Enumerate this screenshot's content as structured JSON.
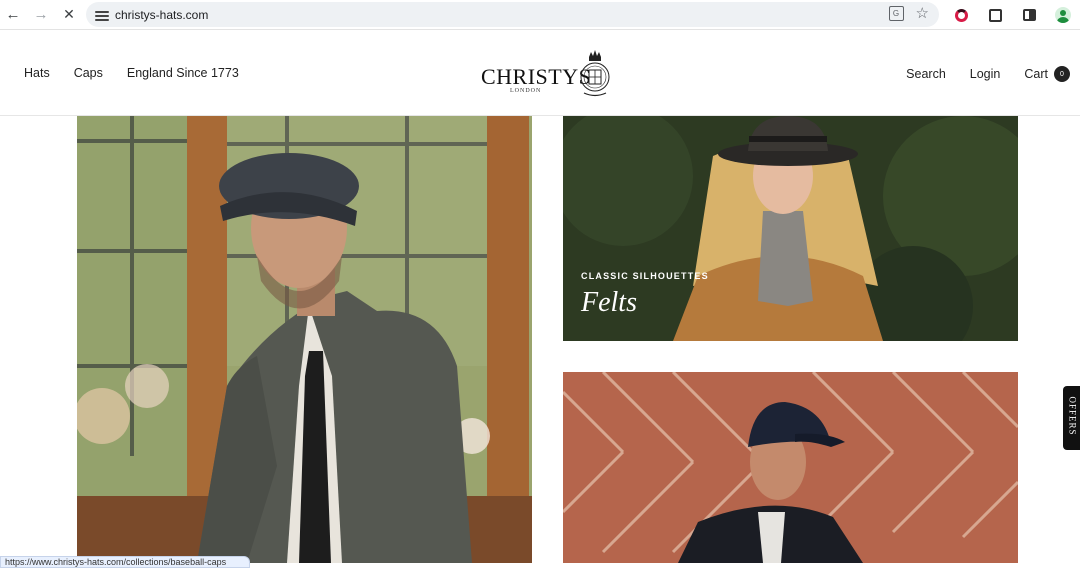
{
  "browser": {
    "url": "christys-hats.com"
  },
  "header": {
    "nav_left": [
      "Hats",
      "Caps",
      "England Since 1773"
    ],
    "logo_text": "CHRISTYS'",
    "logo_sub": "LONDON",
    "search_label": "Search",
    "login_label": "Login",
    "cart_label": "Cart",
    "cart_count": "0"
  },
  "tiles": {
    "felts": {
      "eyebrow": "CLASSIC SILHOUETTES",
      "title": "Felts"
    }
  },
  "side_tab": {
    "label": "OFFERS"
  },
  "status_bar": {
    "text": "https://www.christys-hats.com/collections/baseball-caps"
  },
  "colors": {
    "accent": "#111111",
    "status_bg": "#e8f0fe"
  }
}
